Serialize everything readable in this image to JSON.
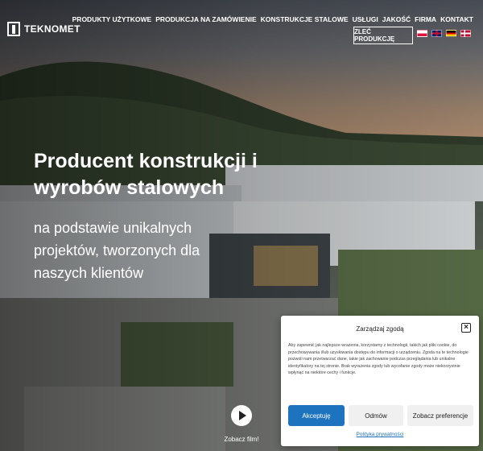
{
  "brand": {
    "name": "TEKNOMET"
  },
  "nav": {
    "items": [
      "PRODUKTY UŻYTKOWE",
      "PRODUKCJA NA ZAMÓWIENIE",
      "KONSTRUKCJE STALOWE",
      "USŁUGI",
      "JAKOŚĆ",
      "FIRMA",
      "KONTAKT"
    ],
    "cta": "ZLEĆ PRODUKCJĘ"
  },
  "languages": [
    "pl-flag-icon",
    "en-flag-icon",
    "de-flag-icon",
    "no-flag-icon"
  ],
  "hero": {
    "title": "Producent konstrukcji i wyrobów stalowych",
    "subtitle": "na podstawie unikalnych projektów, tworzonych dla naszych klientów",
    "video_label": "Zobacz film!"
  },
  "consent": {
    "title": "Zarządzaj zgodą",
    "body": "Aby zapewnić jak najlepsze wrażenia, korzystamy z technologii, takich jak pliki cookie, do przechowywania i/lub uzyskiwania dostępu do informacji o urządzeniu. Zgoda na te technologie pozwoli nam przetwarzać dane, takie jak zachowanie podczas przeglądania lub unikalne identyfikatory na tej stronie. Brak wyrażenia zgody lub wycofanie zgody może niekorzystnie wpłynąć na niektóre cechy i funkcje.",
    "accept": "Akceptuję",
    "deny": "Odmów",
    "preferences": "Zobacz preferencje",
    "privacy_link": "Polityka prywatności",
    "close_icon": "close-icon"
  },
  "colors": {
    "accent": "#1e73be",
    "text_light": "#ffffff"
  }
}
